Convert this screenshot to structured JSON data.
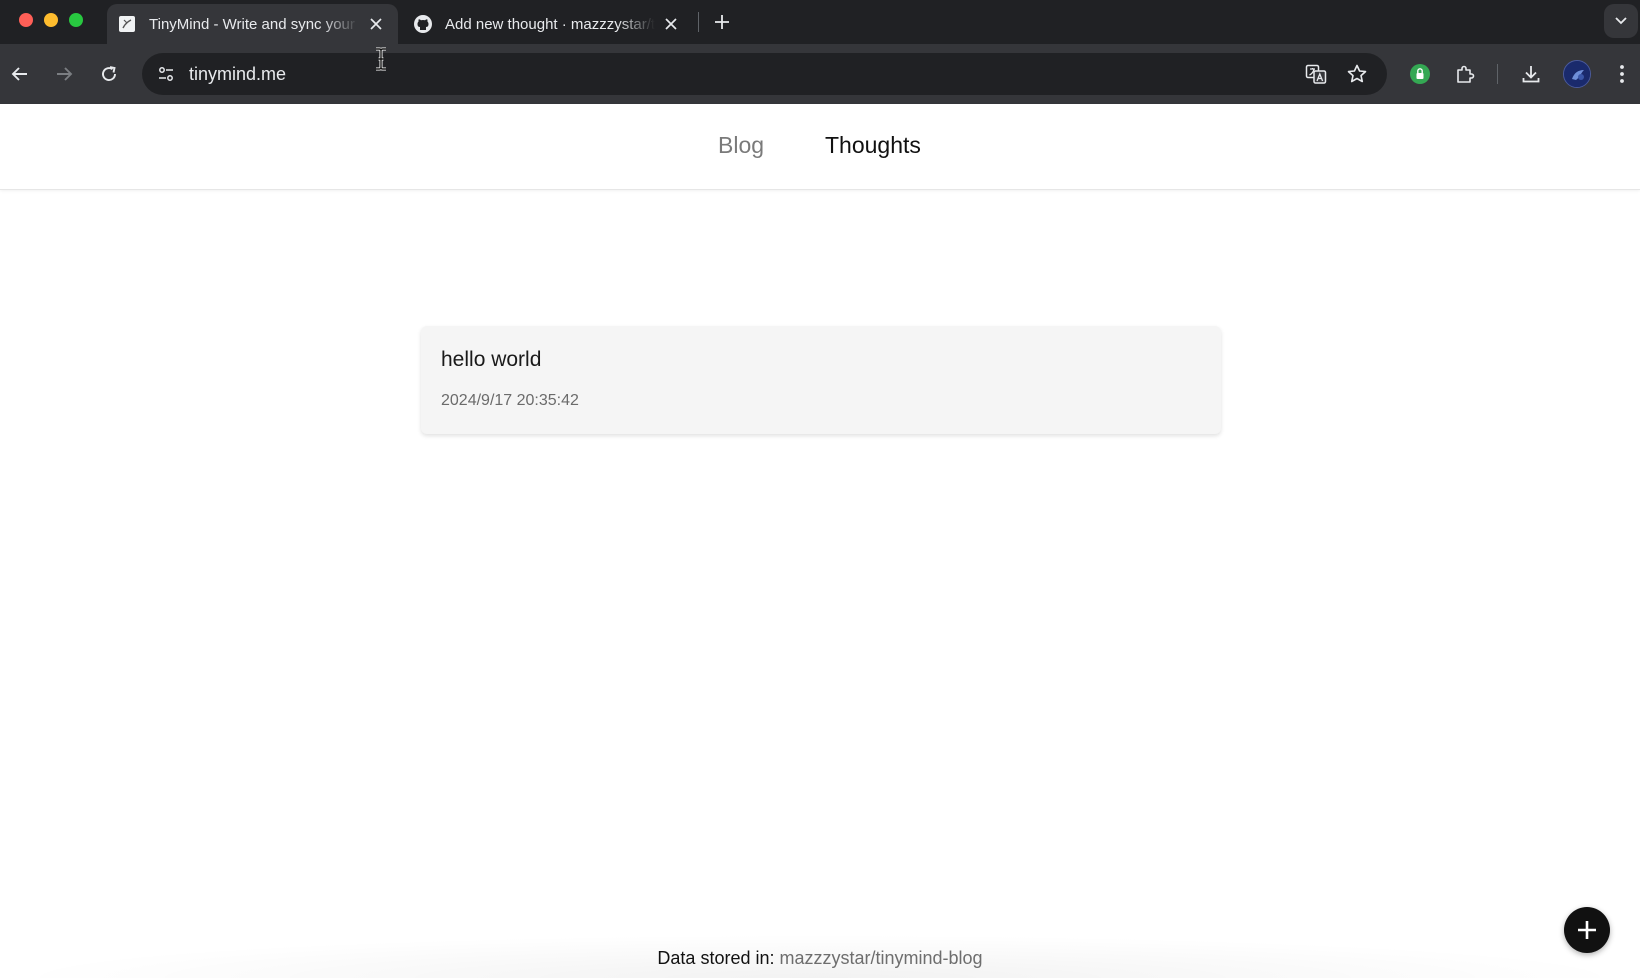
{
  "browser": {
    "tabs": [
      {
        "title": "TinyMind - Write and sync your thoughts",
        "active": true,
        "icon": "tinymind-favicon"
      },
      {
        "title": "Add new thought · mazzzystar/tinymind-blog",
        "active": false,
        "icon": "github-icon"
      }
    ],
    "url": "tinymind.me",
    "extension_color": "#34a853"
  },
  "nav": {
    "blog": "Blog",
    "thoughts": "Thoughts",
    "active": "Thoughts"
  },
  "thoughts": [
    {
      "text": "hello world",
      "date": "2024/9/17 20:35:42"
    }
  ],
  "footer": {
    "label": "Data stored in:",
    "repo": "mazzzystar/tinymind-blog"
  },
  "fab": {
    "icon": "plus-icon"
  }
}
